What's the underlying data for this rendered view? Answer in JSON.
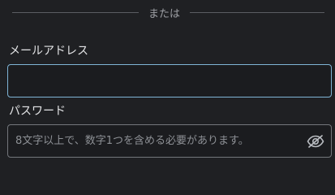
{
  "divider": {
    "text": "または"
  },
  "email": {
    "label": "メールアドレス",
    "value": "",
    "placeholder": ""
  },
  "password": {
    "label": "パスワード",
    "value": "",
    "placeholder": "8文字以上で、数字1つを含める必要があります。",
    "toggle_icon": "eye-off-icon"
  },
  "colors": {
    "background": "#1f2023",
    "focus_border": "#7fb4d6",
    "input_border": "#74777c",
    "divider": "#5b5d62"
  }
}
